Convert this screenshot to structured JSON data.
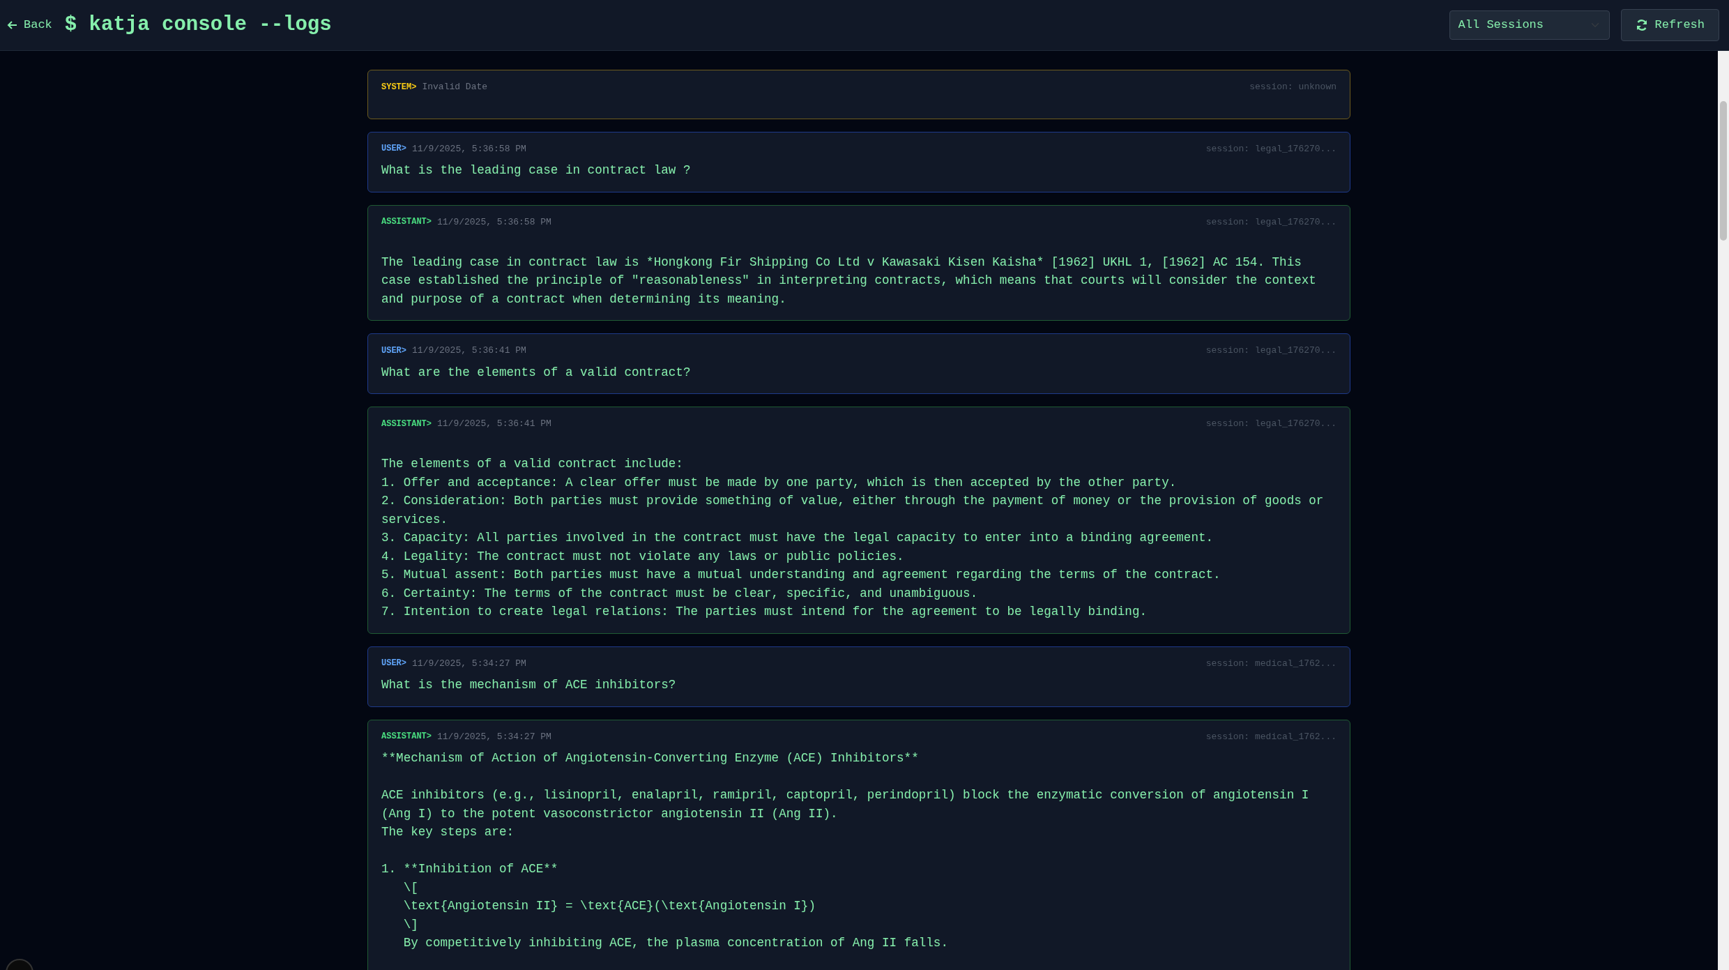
{
  "header": {
    "back_label": "Back",
    "title": "$ katja console --logs",
    "session_filter": "All Sessions",
    "refresh_label": "Refresh"
  },
  "logs": [
    {
      "kind": "system",
      "role_label": "SYSTEM>",
      "timestamp": "Invalid Date",
      "session": "session: unknown"
    },
    {
      "kind": "user",
      "role_label": "USER>",
      "timestamp": "11/9/2025, 5:36:58 PM",
      "session": "session: legal_176270...",
      "content": "What is the leading case in contract law ?"
    },
    {
      "kind": "assistant",
      "role_label": "ASSISTANT>",
      "timestamp": "11/9/2025, 5:36:58 PM",
      "session": "session: legal_176270...",
      "content": "\nThe leading case in contract law is *Hongkong Fir Shipping Co Ltd v Kawasaki Kisen Kaisha* [1962] UKHL 1, [1962] AC 154. This case established the principle of \"reasonableness\" in interpreting contracts, which means that courts will consider the context and purpose of a contract when determining its meaning."
    },
    {
      "kind": "user",
      "role_label": "USER>",
      "timestamp": "11/9/2025, 5:36:41 PM",
      "session": "session: legal_176270...",
      "content": "What are the elements of a valid contract?"
    },
    {
      "kind": "assistant",
      "role_label": "ASSISTANT>",
      "timestamp": "11/9/2025, 5:36:41 PM",
      "session": "session: legal_176270...",
      "content": "\nThe elements of a valid contract include:\n1. Offer and acceptance: A clear offer must be made by one party, which is then accepted by the other party.\n2. Consideration: Both parties must provide something of value, either through the payment of money or the provision of goods or services.\n3. Capacity: All parties involved in the contract must have the legal capacity to enter into a binding agreement.\n4. Legality: The contract must not violate any laws or public policies.\n5. Mutual assent: Both parties must have a mutual understanding and agreement regarding the terms of the contract.\n6. Certainty: The terms of the contract must be clear, specific, and unambiguous.\n7. Intention to create legal relations: The parties must intend for the agreement to be legally binding."
    },
    {
      "kind": "user",
      "role_label": "USER>",
      "timestamp": "11/9/2025, 5:34:27 PM",
      "session": "session: medical_1762...",
      "content": "What is the mechanism of ACE inhibitors?"
    },
    {
      "kind": "assistant",
      "role_label": "ASSISTANT>",
      "timestamp": "11/9/2025, 5:34:27 PM",
      "session": "session: medical_1762...",
      "content": "**Mechanism of Action of Angiotensin-Converting Enzyme (ACE) Inhibitors**\n\nACE inhibitors (e.g., lisinopril, enalapril, ramipril, captopril, perindopril) block the enzymatic conversion of angiotensin I (Ang I) to the potent vasoconstrictor angiotensin II (Ang II).\nThe key steps are:\n\n1. **Inhibition of ACE**\n   \\[\n   \\text{Angiotensin II} = \\text{ACE}(\\text{Angiotensin I})\n   \\]\n   By competitively inhibiting ACE, the plasma concentration of Ang II falls."
    }
  ]
}
